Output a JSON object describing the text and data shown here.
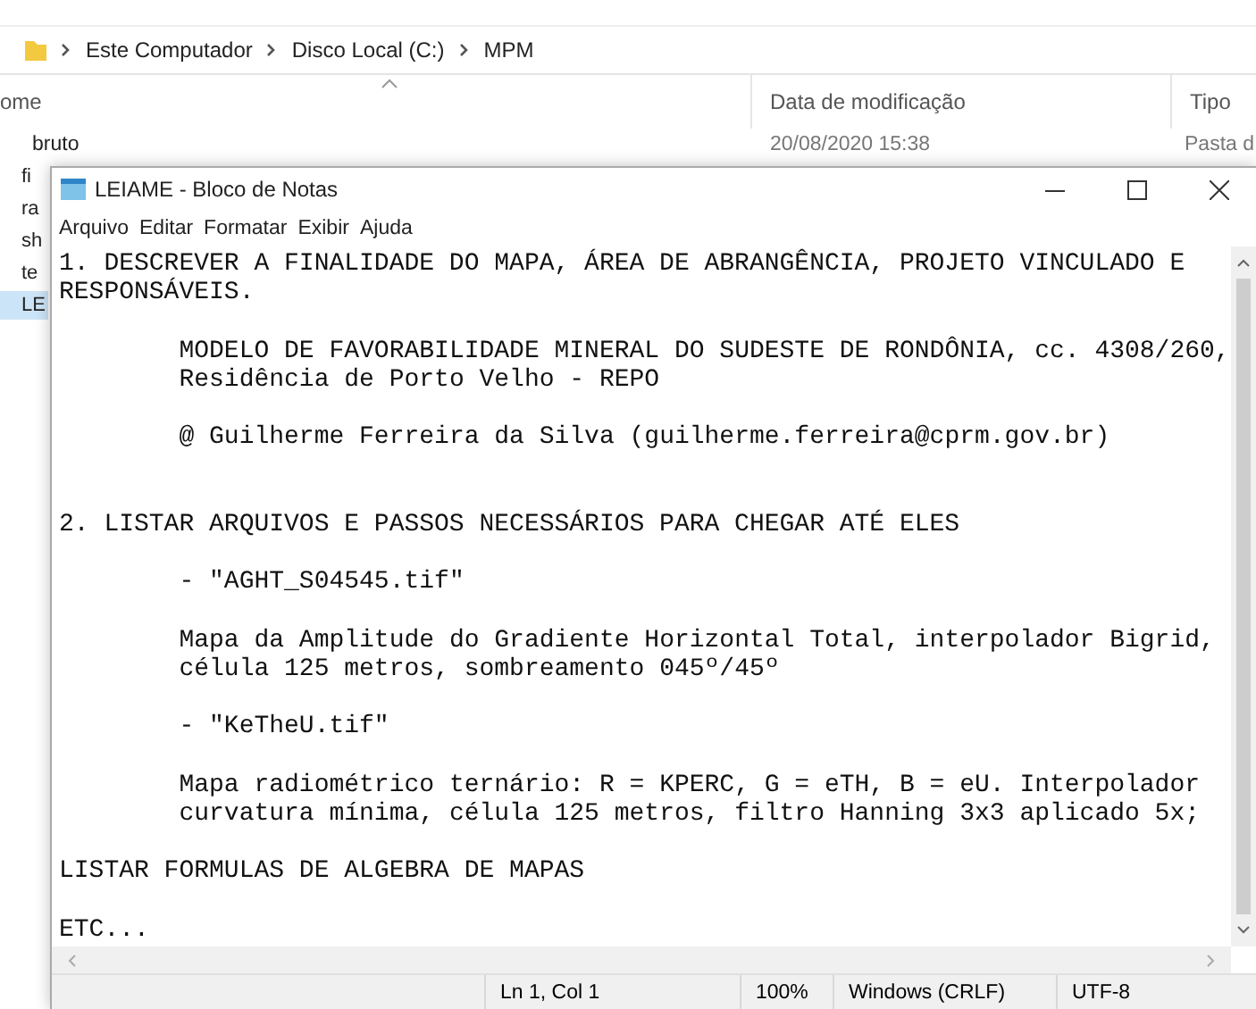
{
  "explorer": {
    "breadcrumb": [
      "Este Computador",
      "Disco Local (C:)",
      "MPM"
    ],
    "columns": [
      "ome",
      "Data de modificação",
      "Tipo"
    ],
    "rows": [
      {
        "name": "bruto",
        "modified": "20/08/2020 15:38",
        "type": "Pasta d",
        "selected": false
      },
      {
        "name": "fi",
        "selected": false
      },
      {
        "name": "ra",
        "selected": false
      },
      {
        "name": "sh",
        "selected": false
      },
      {
        "name": "te",
        "selected": false
      },
      {
        "name": "LE",
        "selected": true
      }
    ]
  },
  "notepad": {
    "title": "LEIAME - Bloco de Notas",
    "menu": [
      "Arquivo",
      "Editar",
      "Formatar",
      "Exibir",
      "Ajuda"
    ],
    "text": "1. DESCREVER A FINALIDADE DO MAPA, ÁREA DE ABRANGÊNCIA, PROJETO VINCULADO E\nRESPONSÁVEIS.\n\n\tMODELO DE FAVORABILIDADE MINERAL DO SUDESTE DE RONDÔNIA, cc. 4308/260,\n\tResidência de Porto Velho - REPO\n\n\t@ Guilherme Ferreira da Silva (guilherme.ferreira@cprm.gov.br)\n\n\n2. LISTAR ARQUIVOS E PASSOS NECESSÁRIOS PARA CHEGAR ATÉ ELES\n\n\t- \"AGHT_S04545.tif\"\n\n\tMapa da Amplitude do Gradiente Horizontal Total, interpolador Bigrid,\n\tcélula 125 metros, sombreamento 045º/45º\n\n\t- \"KeTheU.tif\"\n\n\tMapa radiométrico ternário: R = KPERC, G = eTH, B = eU. Interpolador\n\tcurvatura mínima, célula 125 metros, filtro Hanning 3x3 aplicado 5x;\n\nLISTAR FORMULAS DE ALGEBRA DE MAPAS\n\nETC...",
    "status": [
      "Ln 1, Col 1",
      "100%",
      "Windows (CRLF)",
      "UTF-8"
    ]
  }
}
